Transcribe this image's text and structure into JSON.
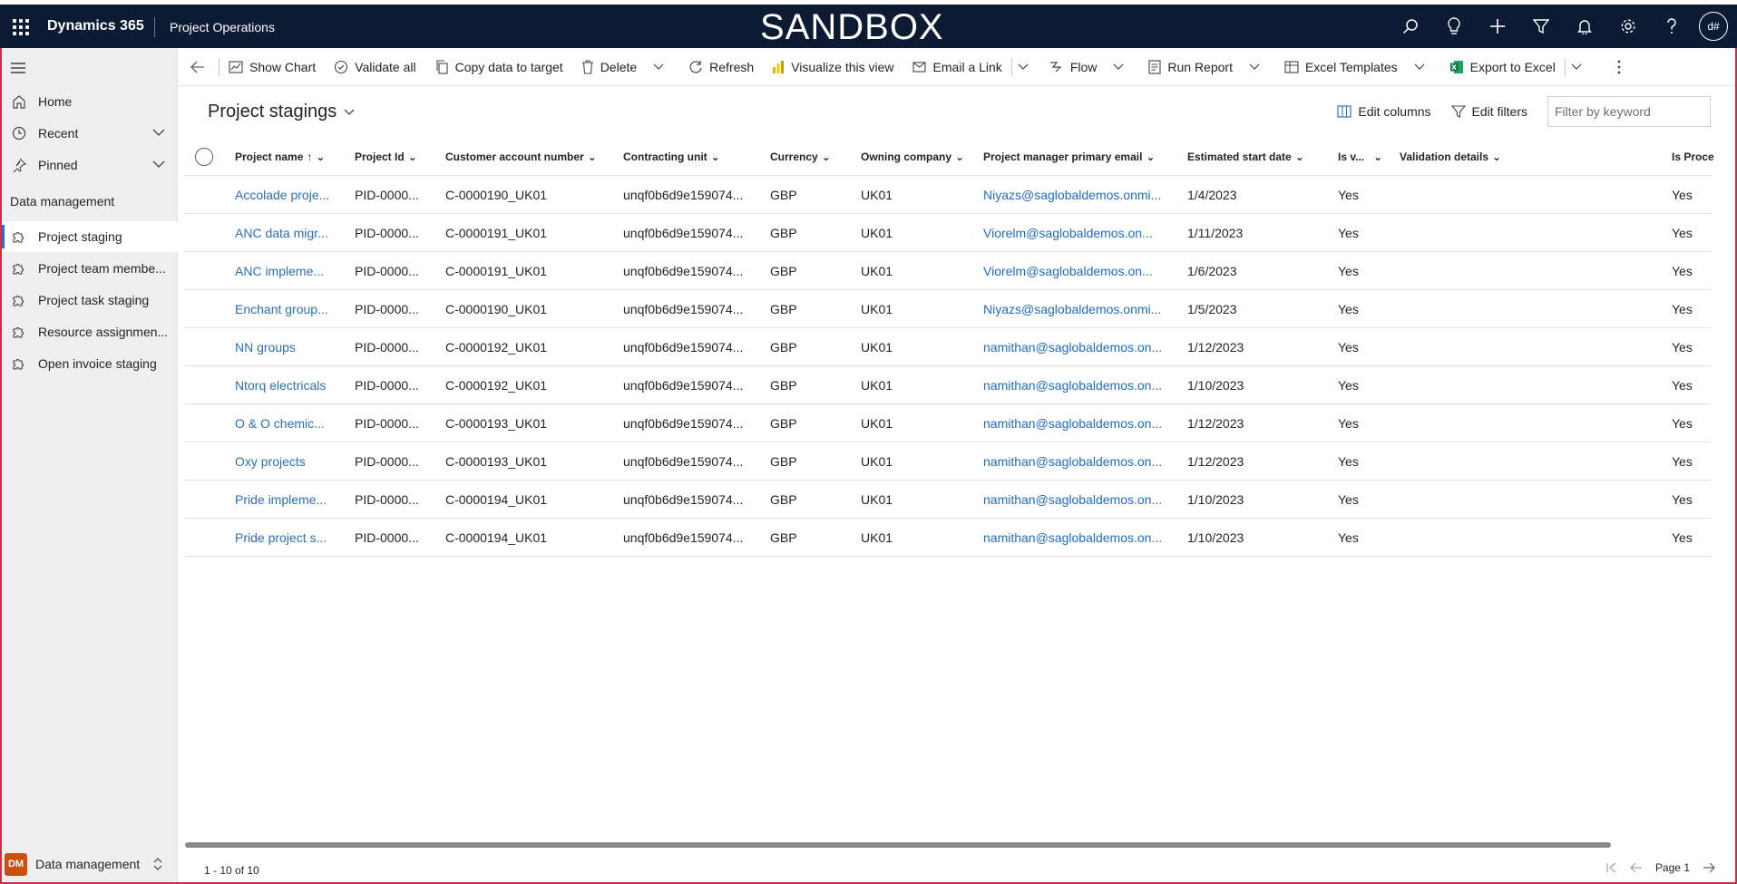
{
  "topbar": {
    "app_name": "Dynamics 365",
    "area_name": "Project Operations",
    "banner": "SANDBOX",
    "avatar_initials": "d#"
  },
  "sidebar": {
    "items_top": [
      {
        "label": "Home",
        "icon": "home-icon"
      },
      {
        "label": "Recent",
        "icon": "clock-icon"
      },
      {
        "label": "Pinned",
        "icon": "pin-icon"
      }
    ],
    "section_title": "Data management",
    "items": [
      {
        "label": "Project staging",
        "icon": "puzzle-icon",
        "active": true
      },
      {
        "label": "Project team membe...",
        "icon": "puzzle-icon"
      },
      {
        "label": "Project task staging",
        "icon": "puzzle-icon"
      },
      {
        "label": "Resource assignmen...",
        "icon": "puzzle-icon"
      },
      {
        "label": "Open invoice staging",
        "icon": "puzzle-icon"
      }
    ],
    "area_badge": "DM",
    "area_switcher": "Data management"
  },
  "commands": {
    "show_chart": "Show Chart",
    "validate_all": "Validate all",
    "copy_data": "Copy data to target",
    "delete": "Delete",
    "refresh": "Refresh",
    "visualize": "Visualize this view",
    "email_link": "Email a Link",
    "flow": "Flow",
    "run_report": "Run Report",
    "excel_templates": "Excel Templates",
    "export_excel": "Export to Excel"
  },
  "view": {
    "title": "Project stagings",
    "edit_columns": "Edit columns",
    "edit_filters": "Edit filters",
    "filter_placeholder": "Filter by keyword"
  },
  "grid": {
    "columns": [
      "Project name",
      "Project Id",
      "Customer account number",
      "Contracting unit",
      "Currency",
      "Owning company",
      "Project manager primary email",
      "Estimated start date",
      "Is v...",
      "Validation details",
      "Is Proce"
    ],
    "rows": [
      [
        "Accolade proje...",
        "PID-0000...",
        "C-0000190_UK01",
        "unqf0b6d9e159074...",
        "GBP",
        "UK01",
        "Niyazs@saglobaldemos.onmi...",
        "1/4/2023",
        "Yes",
        "",
        "Yes"
      ],
      [
        "ANC data migr...",
        "PID-0000...",
        "C-0000191_UK01",
        "unqf0b6d9e159074...",
        "GBP",
        "UK01",
        "Viorelm@saglobaldemos.on...",
        "1/11/2023",
        "Yes",
        "",
        "Yes"
      ],
      [
        "ANC impleme...",
        "PID-0000...",
        "C-0000191_UK01",
        "unqf0b6d9e159074...",
        "GBP",
        "UK01",
        "Viorelm@saglobaldemos.on...",
        "1/6/2023",
        "Yes",
        "",
        "Yes"
      ],
      [
        "Enchant group...",
        "PID-0000...",
        "C-0000190_UK01",
        "unqf0b6d9e159074...",
        "GBP",
        "UK01",
        "Niyazs@saglobaldemos.onmi...",
        "1/5/2023",
        "Yes",
        "",
        "Yes"
      ],
      [
        "NN groups",
        "PID-0000...",
        "C-0000192_UK01",
        "unqf0b6d9e159074...",
        "GBP",
        "UK01",
        "namithan@saglobaldemos.on...",
        "1/12/2023",
        "Yes",
        "",
        "Yes"
      ],
      [
        "Ntorq electricals",
        "PID-0000...",
        "C-0000192_UK01",
        "unqf0b6d9e159074...",
        "GBP",
        "UK01",
        "namithan@saglobaldemos.on...",
        "1/10/2023",
        "Yes",
        "",
        "Yes"
      ],
      [
        "O & O chemic...",
        "PID-0000...",
        "C-0000193_UK01",
        "unqf0b6d9e159074...",
        "GBP",
        "UK01",
        "namithan@saglobaldemos.on...",
        "1/12/2023",
        "Yes",
        "",
        "Yes"
      ],
      [
        "Oxy projects",
        "PID-0000...",
        "C-0000193_UK01",
        "unqf0b6d9e159074...",
        "GBP",
        "UK01",
        "namithan@saglobaldemos.on...",
        "1/12/2023",
        "Yes",
        "",
        "Yes"
      ],
      [
        "Pride impleme...",
        "PID-0000...",
        "C-0000194_UK01",
        "unqf0b6d9e159074...",
        "GBP",
        "UK01",
        "namithan@saglobaldemos.on...",
        "1/10/2023",
        "Yes",
        "",
        "Yes"
      ],
      [
        "Pride project s...",
        "PID-0000...",
        "C-0000194_UK01",
        "unqf0b6d9e159074...",
        "GBP",
        "UK01",
        "namithan@saglobaldemos.on...",
        "1/10/2023",
        "Yes",
        "",
        "Yes"
      ]
    ]
  },
  "footer": {
    "record_count": "1 - 10 of 10",
    "page_label": "Page 1"
  },
  "colors": {
    "topbar": "#0c1b33",
    "link": "#1f6bc7",
    "accent": "#1a6ed8",
    "area_badge": "#ca5010"
  }
}
